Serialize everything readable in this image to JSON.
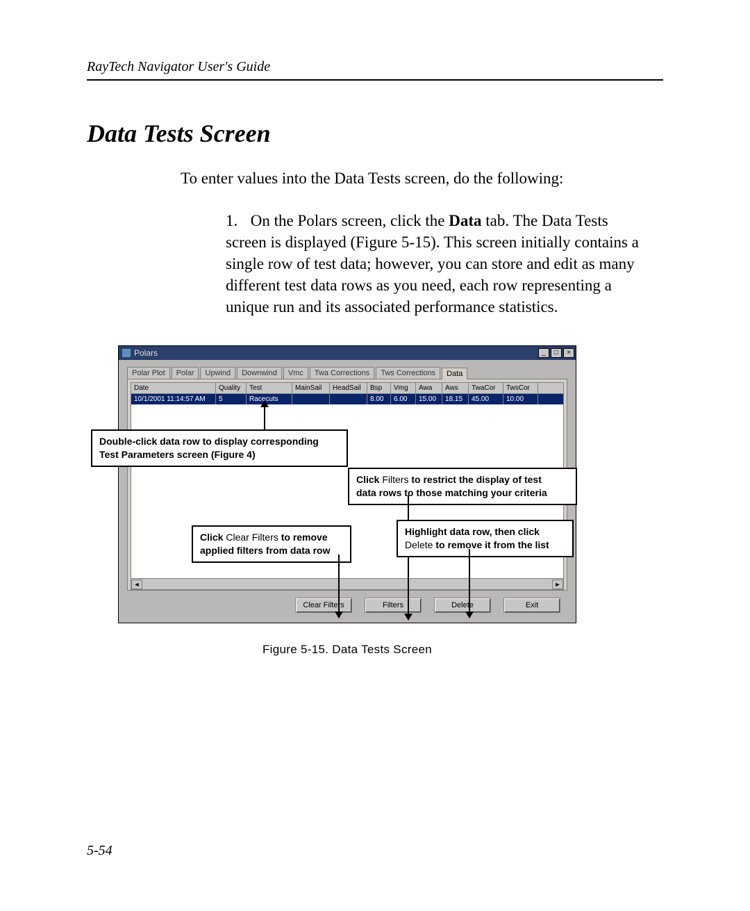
{
  "header_running": "RayTech Navigator User's Guide",
  "section_title": "Data Tests Screen",
  "intro": "To enter values into the Data Tests screen, do the following:",
  "step1_num": "1.",
  "step1_a": "On the Polars screen, click the ",
  "step1_bold": "Data",
  "step1_b": " tab.  The Data Tests screen is displayed (Figure 5-15).  This screen initially contains a single row of test data; however, you can store and edit as many different test data rows as you need, each row representing a unique run and its associated performance statistics.",
  "window": {
    "title": "Polars",
    "min": "_",
    "max": "□",
    "close": "×",
    "tabs": [
      "Polar Plot",
      "Polar",
      "Upwind",
      "Downwind",
      "Vmc",
      "Twa Corrections",
      "Tws Corrections",
      "Data"
    ],
    "active_tab_index": 7,
    "columns": [
      "Date",
      "Quality",
      "Test",
      "MainSail",
      "HeadSail",
      "Bsp",
      "Vmg",
      "Awa",
      "Aws",
      "TwaCor",
      "TwsCor"
    ],
    "row": {
      "Date": "10/1/2001 11:14:57 AM",
      "Quality": "5",
      "Test": "Racecuts",
      "MainSail": "",
      "HeadSail": "",
      "Bsp": "8.00",
      "Vmg": "6.00",
      "Awa": "15.00",
      "Aws": "18.15",
      "TwaCor": "45.00",
      "TwsCor": "10.00"
    },
    "scroll_left": "◄",
    "scroll_right": "►",
    "buttons": {
      "clear": "Clear Filters",
      "filters": "Filters",
      "delete": "Delete",
      "exit": "Exit"
    }
  },
  "callouts": {
    "top_left_a": "Double-click data row to display corresponding",
    "top_left_b": "Test Parameters screen (Figure 4)",
    "right_a": "Click ",
    "right_a_nb": "Filters",
    "right_a2": " to restrict the display of test",
    "right_b": "data rows to those matching your criteria",
    "delete_a": "Highlight data row, then click",
    "delete_b_nb": "Delete",
    "delete_b2": " to remove it from the list",
    "clear_a": "Click ",
    "clear_a_nb": "Clear Filters",
    "clear_a2": " to remove",
    "clear_b": "applied filters from data row"
  },
  "figure_caption": "Figure 5-15.  Data Tests Screen",
  "page_number": "5-54"
}
